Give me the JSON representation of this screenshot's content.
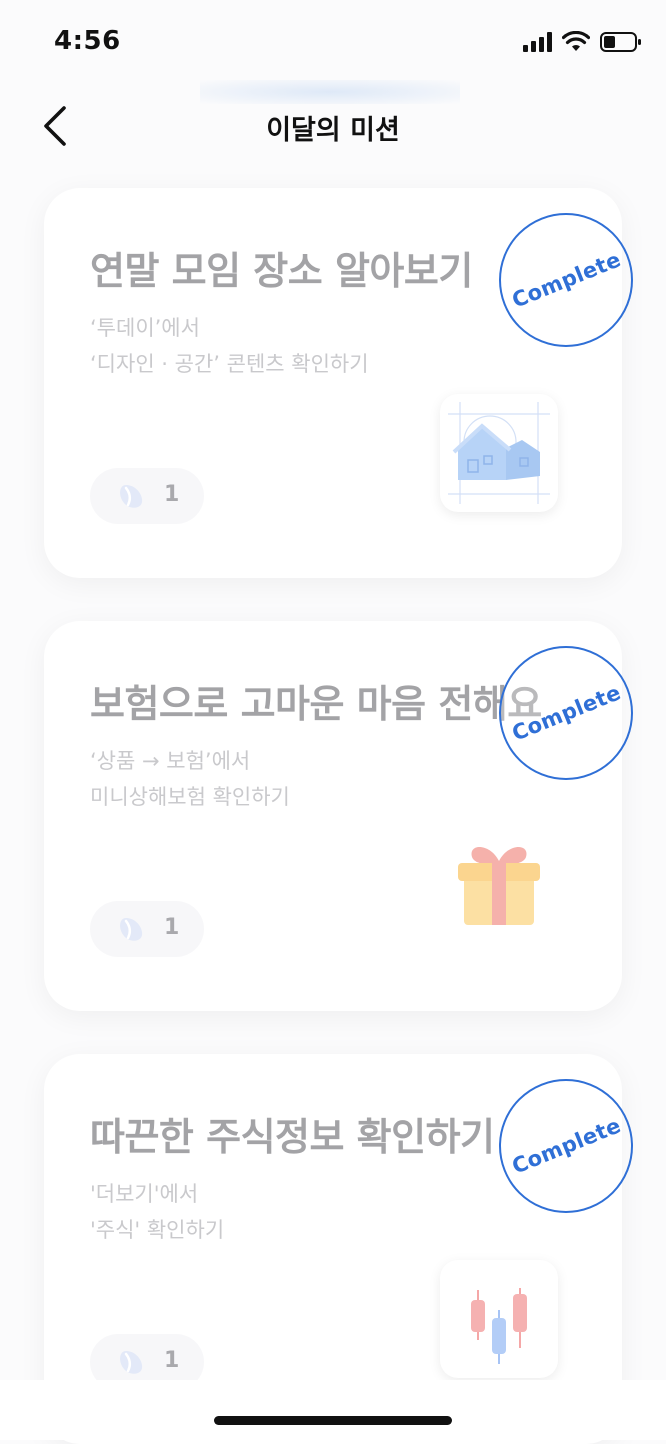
{
  "status_bar": {
    "time": "4:56"
  },
  "header": {
    "title": "이달의 미션"
  },
  "missions": [
    {
      "title": "연말 모임 장소 알아보기",
      "desc_line1": "‘투데이’에서",
      "desc_line2": "‘디자인 · 공간’ 콘텐츠 확인하기",
      "reward_count": "1",
      "stamp": "Complete",
      "thumb_icon": "house-icon"
    },
    {
      "title": "보험으로 고마운 마음 전해요",
      "desc_line1": "‘상품 → 보험’에서",
      "desc_line2": "미니상해보험 확인하기",
      "reward_count": "1",
      "stamp": "Complete",
      "thumb_icon": "gift-icon"
    },
    {
      "title": "따끈한 주식정보 확인하기",
      "desc_line1": "'더보기'에서",
      "desc_line2": "'주식' 확인하기",
      "reward_count": "1",
      "stamp": "Complete",
      "thumb_icon": "candlestick-chart-icon"
    }
  ],
  "colors": {
    "stamp_blue": "#2f6fd6",
    "title_gray": "#a3a3a6",
    "desc_gray": "#c9c9cc"
  }
}
